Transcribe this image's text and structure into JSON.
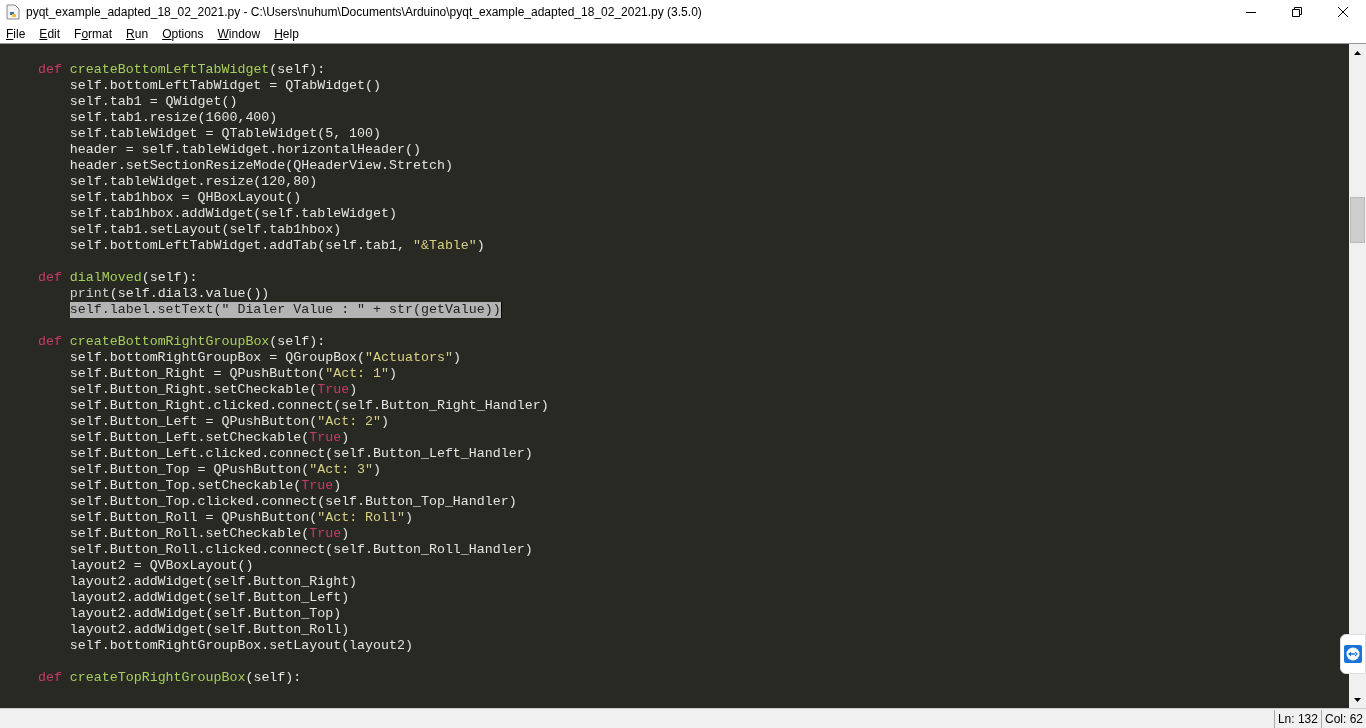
{
  "window": {
    "title": "pyqt_example_adapted_18_02_2021.py - C:\\Users\\nuhum\\Documents\\Arduino\\pyqt_example_adapted_18_02_2021.py (3.5.0)"
  },
  "menu": [
    {
      "key": "F",
      "post": "ile"
    },
    {
      "key": "E",
      "post": "dit"
    },
    {
      "pre": "F",
      "key": "o",
      "post": "rmat"
    },
    {
      "key": "R",
      "post": "un"
    },
    {
      "key": "O",
      "post": "ptions"
    },
    {
      "key": "W",
      "post": "indow"
    },
    {
      "key": "H",
      "post": "elp"
    }
  ],
  "lines": [
    {
      "kind": "blank"
    },
    {
      "tokens": [
        {
          "kind": "keyword",
          "text": "    def"
        },
        {
          "kind": "funcname",
          "text": " createBottomLeftTabWidget"
        },
        {
          "kind": "plain",
          "text": "(self):"
        }
      ]
    },
    {
      "tokens": [
        {
          "kind": "plain",
          "text": "        self.bottomLeftTabWidget = QTabWidget()"
        }
      ]
    },
    {
      "tokens": [
        {
          "kind": "plain",
          "text": "        self.tab1 = QWidget()"
        }
      ]
    },
    {
      "tokens": [
        {
          "kind": "plain",
          "text": "        self.tab1.resize(1600,400)"
        }
      ]
    },
    {
      "tokens": [
        {
          "kind": "plain",
          "text": "        self.tableWidget = QTableWidget(5, 100)"
        }
      ]
    },
    {
      "tokens": [
        {
          "kind": "plain",
          "text": "        header = self.tableWidget.horizontalHeader()"
        }
      ]
    },
    {
      "tokens": [
        {
          "kind": "plain",
          "text": "        header.setSectionResizeMode(QHeaderView.Stretch)"
        }
      ]
    },
    {
      "tokens": [
        {
          "kind": "plain",
          "text": "        self.tableWidget.resize(120,80)"
        }
      ]
    },
    {
      "tokens": [
        {
          "kind": "plain",
          "text": "        self.tab1hbox = QHBoxLayout()"
        }
      ]
    },
    {
      "tokens": [
        {
          "kind": "plain",
          "text": "        self.tab1hbox.addWidget(self.tableWidget)"
        }
      ]
    },
    {
      "tokens": [
        {
          "kind": "plain",
          "text": "        self.tab1.setLayout(self.tab1hbox)"
        }
      ]
    },
    {
      "tokens": [
        {
          "kind": "plain",
          "text": "        self.bottomLeftTabWidget.addTab(self.tab1, "
        },
        {
          "kind": "string",
          "text": "\"&Table\""
        },
        {
          "kind": "plain",
          "text": ")"
        }
      ]
    },
    {
      "kind": "blank"
    },
    {
      "tokens": [
        {
          "kind": "keyword",
          "text": "    def"
        },
        {
          "kind": "funcname",
          "text": " dialMoved"
        },
        {
          "kind": "plain",
          "text": "(self):"
        }
      ]
    },
    {
      "tokens": [
        {
          "kind": "builtin",
          "text": "        print"
        },
        {
          "kind": "plain",
          "text": "(self.dial3.value())"
        }
      ]
    },
    {
      "highlighted": true,
      "tokens": [
        {
          "kind": "plain",
          "text": "        self.label.setText(\" Dialer Value : \" + str(getValue))"
        }
      ]
    },
    {
      "kind": "blank"
    },
    {
      "tokens": [
        {
          "kind": "keyword",
          "text": "    def"
        },
        {
          "kind": "funcname",
          "text": " createBottomRightGroupBox"
        },
        {
          "kind": "plain",
          "text": "(self):"
        }
      ]
    },
    {
      "tokens": [
        {
          "kind": "plain",
          "text": "        self.bottomRightGroupBox = QGroupBox("
        },
        {
          "kind": "string",
          "text": "\"Actuators\""
        },
        {
          "kind": "plain",
          "text": ")"
        }
      ]
    },
    {
      "tokens": [
        {
          "kind": "plain",
          "text": "        self.Button_Right = QPushButton("
        },
        {
          "kind": "string",
          "text": "\"Act: 1\""
        },
        {
          "kind": "plain",
          "text": ")"
        }
      ]
    },
    {
      "tokens": [
        {
          "kind": "plain",
          "text": "        self.Button_Right.setCheckable("
        },
        {
          "kind": "keyword",
          "text": "True"
        },
        {
          "kind": "plain",
          "text": ")"
        }
      ]
    },
    {
      "tokens": [
        {
          "kind": "plain",
          "text": "        self.Button_Right.clicked.connect(self.Button_Right_Handler)"
        }
      ]
    },
    {
      "tokens": [
        {
          "kind": "plain",
          "text": "        self.Button_Left = QPushButton("
        },
        {
          "kind": "string",
          "text": "\"Act: 2\""
        },
        {
          "kind": "plain",
          "text": ")"
        }
      ]
    },
    {
      "tokens": [
        {
          "kind": "plain",
          "text": "        self.Button_Left.setCheckable("
        },
        {
          "kind": "keyword",
          "text": "True"
        },
        {
          "kind": "plain",
          "text": ")"
        }
      ]
    },
    {
      "tokens": [
        {
          "kind": "plain",
          "text": "        self.Button_Left.clicked.connect(self.Button_Left_Handler)"
        }
      ]
    },
    {
      "tokens": [
        {
          "kind": "plain",
          "text": "        self.Button_Top = QPushButton("
        },
        {
          "kind": "string",
          "text": "\"Act: 3\""
        },
        {
          "kind": "plain",
          "text": ")"
        }
      ]
    },
    {
      "tokens": [
        {
          "kind": "plain",
          "text": "        self.Button_Top.setCheckable("
        },
        {
          "kind": "keyword",
          "text": "True"
        },
        {
          "kind": "plain",
          "text": ")"
        }
      ]
    },
    {
      "tokens": [
        {
          "kind": "plain",
          "text": "        self.Button_Top.clicked.connect(self.Button_Top_Handler)"
        }
      ]
    },
    {
      "tokens": [
        {
          "kind": "plain",
          "text": "        self.Button_Roll = QPushButton("
        },
        {
          "kind": "string",
          "text": "\"Act: Roll\""
        },
        {
          "kind": "plain",
          "text": ")"
        }
      ]
    },
    {
      "tokens": [
        {
          "kind": "plain",
          "text": "        self.Button_Roll.setCheckable("
        },
        {
          "kind": "keyword",
          "text": "True"
        },
        {
          "kind": "plain",
          "text": ")"
        }
      ]
    },
    {
      "tokens": [
        {
          "kind": "plain",
          "text": "        self.Button_Roll.clicked.connect(self.Button_Roll_Handler)"
        }
      ]
    },
    {
      "tokens": [
        {
          "kind": "plain",
          "text": "        layout2 = QVBoxLayout()"
        }
      ]
    },
    {
      "tokens": [
        {
          "kind": "plain",
          "text": "        layout2.addWidget(self.Button_Right)"
        }
      ]
    },
    {
      "tokens": [
        {
          "kind": "plain",
          "text": "        layout2.addWidget(self.Button_Left)"
        }
      ]
    },
    {
      "tokens": [
        {
          "kind": "plain",
          "text": "        layout2.addWidget(self.Button_Top)"
        }
      ]
    },
    {
      "tokens": [
        {
          "kind": "plain",
          "text": "        layout2.addWidget(self.Button_Roll)"
        }
      ]
    },
    {
      "tokens": [
        {
          "kind": "plain",
          "text": "        self.bottomRightGroupBox.setLayout(layout2)"
        }
      ]
    },
    {
      "kind": "blank"
    },
    {
      "tokens": [
        {
          "kind": "keyword",
          "text": "    def"
        },
        {
          "kind": "funcname",
          "text": " createTopRightGroupBox"
        },
        {
          "kind": "plain",
          "text": "(self):"
        }
      ]
    }
  ],
  "status_bar": {
    "line": "Ln: 132",
    "column": "Col: 62"
  }
}
